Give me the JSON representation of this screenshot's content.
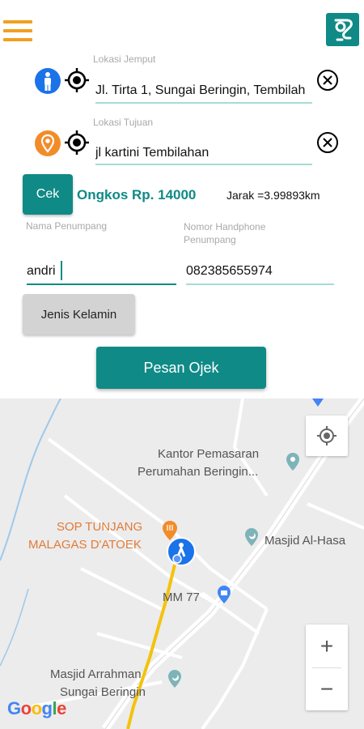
{
  "pickup": {
    "label": "Lokasi Jemput",
    "value": "Jl. Tirta 1, Sungai Beringin, Tembilah"
  },
  "destination": {
    "label": "Lokasi Tujuan",
    "value": "jl kartini Tembilahan"
  },
  "fare": {
    "check_label": "Cek",
    "text": "Ongkos Rp. 14000",
    "distance": "Jarak =3.99893km"
  },
  "passenger": {
    "name_label": "Nama Penumpang",
    "name_value": "andri",
    "phone_label": "Nomor Handphone Penumpang",
    "phone_value": "082385655974"
  },
  "gender_button": "Jenis Kelamin",
  "order_button": "Pesan Ojek",
  "map": {
    "labels": {
      "kantor_line1": "Kantor Pemasaran",
      "kantor_line2": "Perumahan Beringin...",
      "sop_line1": "SOP TUNJANG",
      "sop_line2": "MALAGAS D'ATOEK",
      "masjid_alhasa": "Masjid Al-Hasa",
      "mm77": "MM 77",
      "arrahman_line1": "Masjid Arrahman",
      "arrahman_line2": "Sungai Beringin"
    },
    "zoom_in": "+",
    "zoom_out": "−",
    "google": "Google"
  },
  "icons": [
    "menu-icon",
    "app-logo-icon",
    "person-icon",
    "location-pin-icon",
    "crosshair-icon",
    "clear-icon",
    "my-location-icon",
    "zoom-in-icon",
    "zoom-out-icon"
  ],
  "colors": {
    "primary": "#0f8a86",
    "menu": "#f0a020",
    "person_marker": "#1a73e8",
    "destination_marker": "#f28c28",
    "route": "#f4c20d"
  }
}
